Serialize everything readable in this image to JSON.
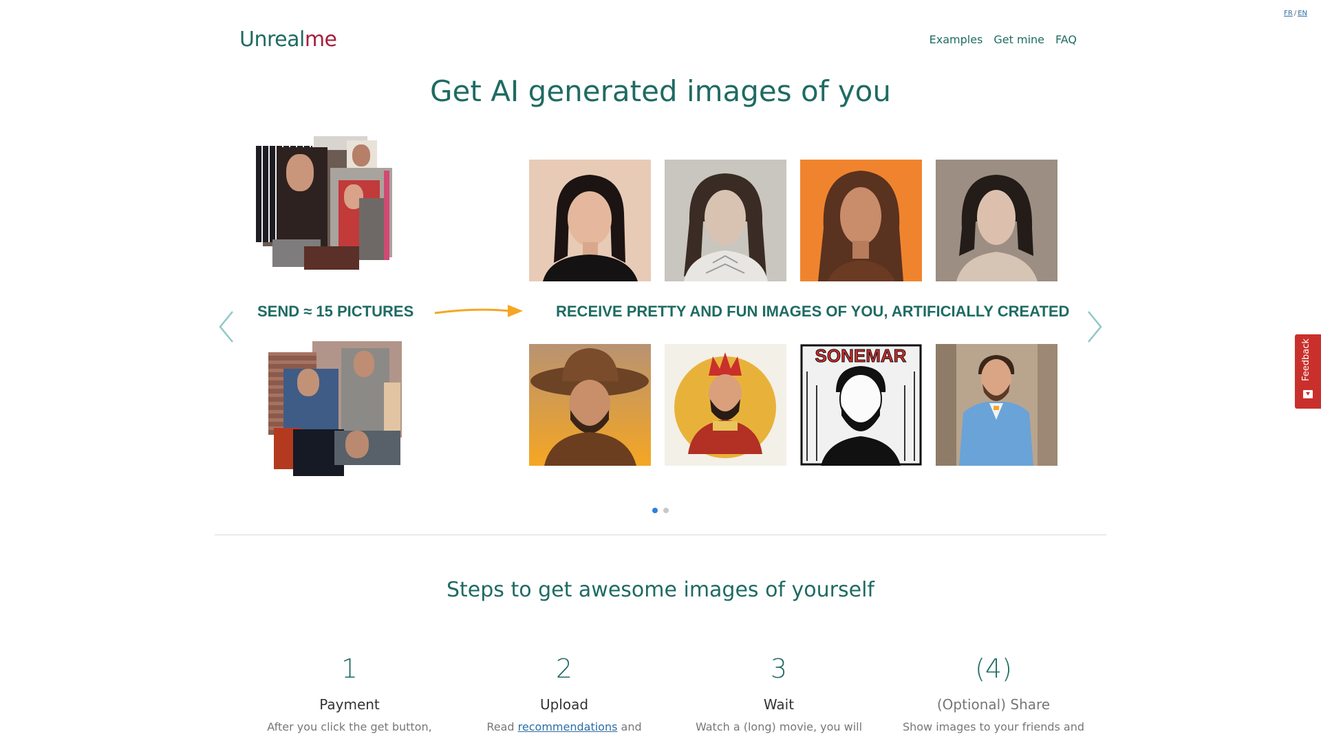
{
  "lang": {
    "fr": "FR",
    "sep": "/",
    "en": "EN"
  },
  "brand": {
    "part1": "Unreal",
    "part2": "me"
  },
  "nav": {
    "examples": "Examples",
    "get_mine": "Get mine",
    "faq": "FAQ"
  },
  "hero": {
    "title": "Get AI generated images of you",
    "send_label": "SEND ≈ 15 PICTURES",
    "receive_label": "RECEIVE PRETTY AND FUN IMAGES OF YOU, ARTIFICIALLY CREATED"
  },
  "carousel": {
    "slides": 2,
    "active_slide": 1
  },
  "steps": {
    "title": "Steps to get awesome images of yourself",
    "items": [
      {
        "num": "1",
        "name": "Payment",
        "desc": "After you click the get button,"
      },
      {
        "num": "2",
        "name": "Upload",
        "desc_prefix": "Read ",
        "desc_link": "recommendations",
        "desc_suffix": " and"
      },
      {
        "num": "3",
        "name": "Wait",
        "desc": "Watch a (long) movie, you will"
      },
      {
        "num": "(4)",
        "name": "(Optional) Share",
        "desc": "Show images to your friends and"
      }
    ]
  },
  "feedback": {
    "label": "Feedback"
  },
  "generated_tiles": {
    "top": [
      "portrait-black-top-icon",
      "portrait-cyborg-icon",
      "portrait-orange-bg-icon",
      "portrait-painted-icon"
    ],
    "bottom": [
      "portrait-cowboy-icon",
      "portrait-king-icon",
      "portrait-comic-icon",
      "portrait-blue-suit-icon"
    ]
  },
  "cowboy_accent": "#f5a623",
  "comic_text": "SONEMAR",
  "colors": {
    "brand": "#1f6b63",
    "accent": "#a61f3d",
    "arrow": "#f5a623",
    "feedback": "#c9302c"
  }
}
